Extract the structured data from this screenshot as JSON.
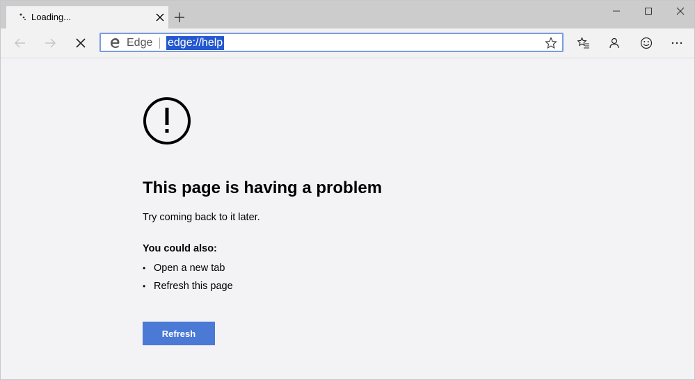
{
  "tab": {
    "title": "Loading..."
  },
  "toolbar": {
    "address_label": "Edge",
    "url": "edge://help"
  },
  "icons": {
    "back": "back-arrow-icon",
    "forward": "forward-arrow-icon",
    "stop": "stop-icon",
    "favorite": "star-icon",
    "favorites_list": "favorites-list-icon",
    "profile": "profile-icon",
    "feedback": "smiley-icon",
    "more": "more-icon",
    "warning": "exclamation-circle-icon"
  },
  "error_page": {
    "heading": "This page is having a problem",
    "subtext": "Try coming back to it later.",
    "also_heading": "You could also:",
    "suggestions": [
      "Open a new tab",
      "Refresh this page"
    ],
    "refresh_label": "Refresh"
  },
  "colors": {
    "accent": "#4a79d6",
    "url_highlight": "#2458d0",
    "address_border": "#7a9be0"
  }
}
